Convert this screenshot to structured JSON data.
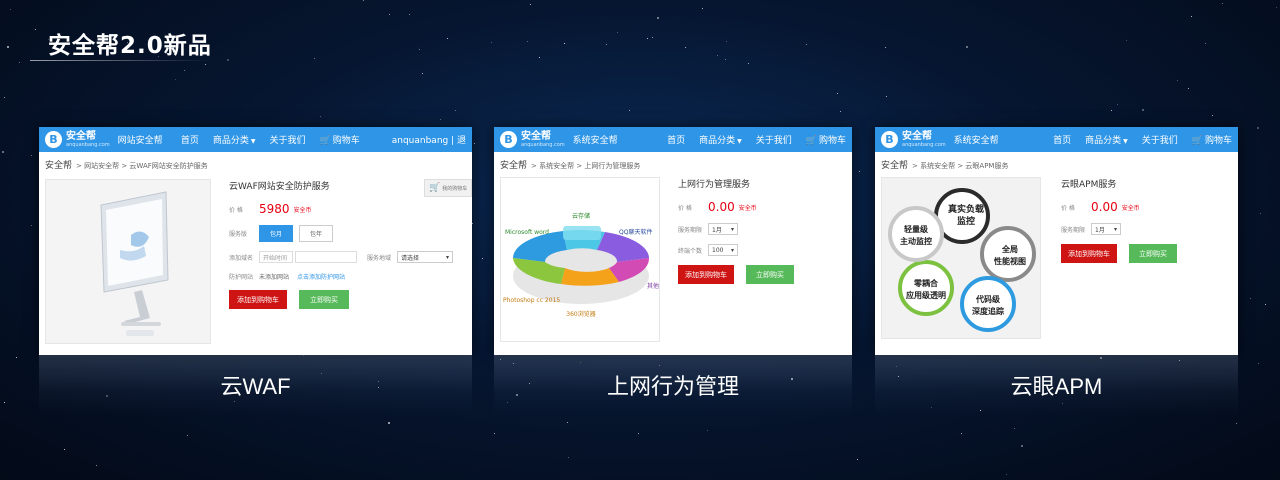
{
  "slide": {
    "title": "安全帮2.0新品"
  },
  "colors": {
    "accent": "#2f95e6",
    "price": "#e60012",
    "cta_red": "#cf1414",
    "cta_green": "#56b95a"
  },
  "panels": [
    {
      "caption": "云WAF",
      "header": {
        "logo": "安全帮",
        "logo_sub": "anquanbang.com",
        "category": "网站安全帮",
        "nav_home": "首页",
        "nav_products": "商品分类",
        "nav_about": "关于我们",
        "nav_cart": "购物车",
        "user": "anquanbang | 退"
      },
      "breadcrumb": {
        "first": "安全帮",
        "rest": "> 网站安全帮 > 云WAF网站安全防护服务"
      },
      "product": {
        "title": "云WAF网站安全防护服务",
        "price_label": "价 格",
        "price": "5980",
        "price_unit": "安全币",
        "plan_label": "服务版",
        "plan_monthly": "包月",
        "plan_yearly": "包年",
        "domain_label": "添加域名",
        "domain_placeholder": "开始时间",
        "region_label": "服务地域",
        "region_value": "请选择",
        "protect_label": "防护网站",
        "protect_value": "未添加网站",
        "protect_link": "点击添加防护网站",
        "btn_cart": "添加到购物车",
        "btn_buy": "立即购买",
        "float_cart": "我的购物车"
      }
    },
    {
      "caption": "上网行为管理",
      "header": {
        "logo": "安全帮",
        "logo_sub": "anquanbang.com",
        "category": "系统安全帮",
        "nav_home": "首页",
        "nav_products": "商品分类",
        "nav_about": "关于我们",
        "nav_cart": "购物车"
      },
      "breadcrumb": {
        "first": "安全帮",
        "rest": "> 系统安全帮 > 上网行为管理服务"
      },
      "product": {
        "title": "上网行为管理服务",
        "price_label": "价 格",
        "price": "0.00",
        "price_unit": "安全币",
        "duration_label": "服务期限",
        "duration_value": "1月",
        "count_label": "终端个数",
        "count_value": "100",
        "btn_cart": "添加到购物车",
        "btn_buy": "立即购买"
      },
      "ring_labels": {
        "top": "云存储",
        "left": "Microsoft word",
        "right": "QQ聊天软件",
        "right_low": "其他",
        "bottom_left": "Photoshop cc 2015",
        "bottom": "360浏览器"
      }
    },
    {
      "caption": "云眼APM",
      "header": {
        "logo": "安全帮",
        "logo_sub": "anquanbang.com",
        "category": "系统安全帮",
        "nav_home": "首页",
        "nav_products": "商品分类",
        "nav_about": "关于我们",
        "nav_cart": "购物车"
      },
      "breadcrumb": {
        "first": "安全帮",
        "rest": "> 系统安全帮 > 云眼APM服务"
      },
      "product": {
        "title": "云眼APM服务",
        "price_label": "价 格",
        "price": "0.00",
        "price_unit": "安全币",
        "duration_label": "服务期限",
        "duration_value": "1月",
        "btn_cart": "添加到购物车",
        "btn_buy": "立即购买"
      },
      "petals": {
        "p1a": "真实负载",
        "p1b": "监控",
        "p2a": "全局",
        "p2b": "性能视图",
        "p3a": "代码级",
        "p3b": "深度追踪",
        "p4a": "零耦合",
        "p4b": "应用级透明",
        "p5a": "轻量级",
        "p5b": "主动监控"
      }
    }
  ]
}
